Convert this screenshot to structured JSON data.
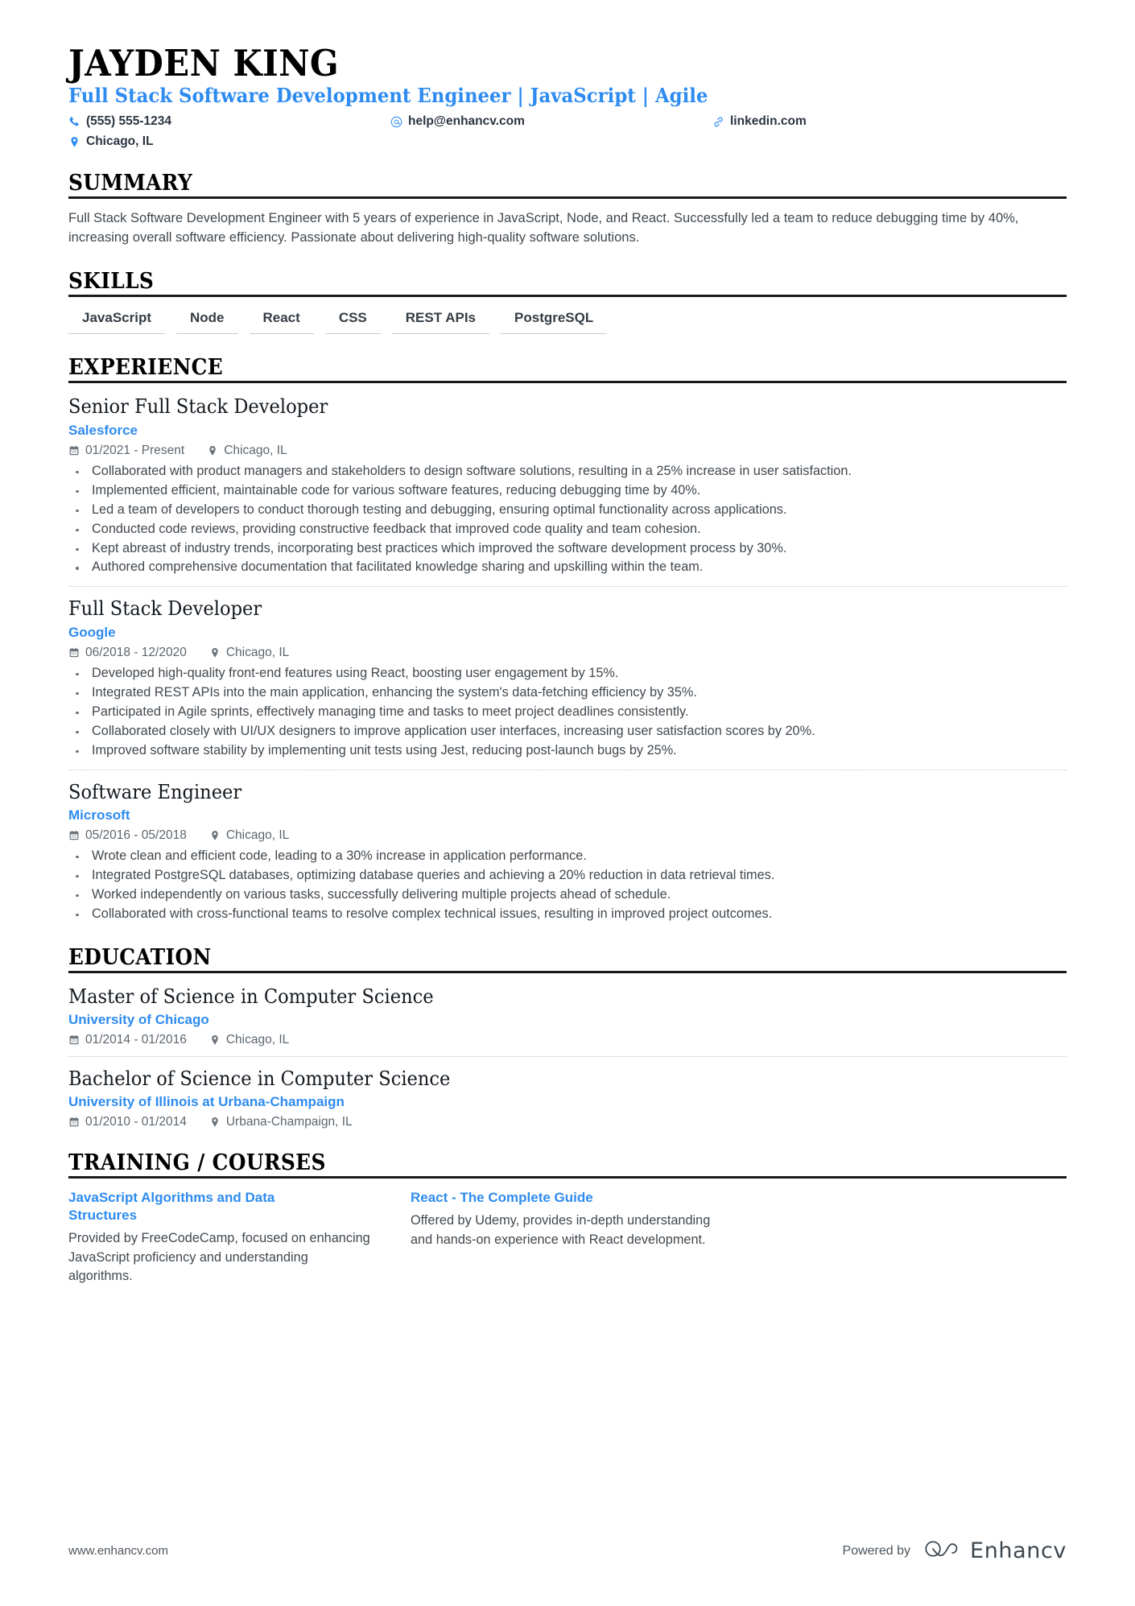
{
  "header": {
    "name": "JAYDEN KING",
    "headline": "Full Stack Software Development Engineer | JavaScript | Agile",
    "contacts": [
      {
        "icon": "phone-icon",
        "text": "(555) 555-1234"
      },
      {
        "icon": "email-icon",
        "text": "help@enhancv.com"
      },
      {
        "icon": "link-icon",
        "text": "linkedin.com"
      },
      {
        "icon": "location-icon",
        "text": "Chicago, IL"
      }
    ]
  },
  "colors": {
    "accent_blue": "#2e8bf0",
    "rule_black": "#1a1a1a",
    "body_text": "#41484f",
    "muted_text": "#5c666f"
  },
  "summary": {
    "title": "SUMMARY",
    "text": "Full Stack Software Development Engineer with 5 years of experience in JavaScript, Node, and React. Successfully led a team to reduce debugging time by 40%, increasing overall software efficiency. Passionate about delivering high-quality software solutions."
  },
  "skills": {
    "title": "SKILLS",
    "items": [
      "JavaScript",
      "Node",
      "React",
      "CSS",
      "REST APIs",
      "PostgreSQL"
    ]
  },
  "experience": {
    "title": "EXPERIENCE",
    "entries": [
      {
        "role": "Senior Full Stack Developer",
        "company": "Salesforce",
        "dates": "01/2021 - Present",
        "location": "Chicago, IL",
        "bullets": [
          "Collaborated with product managers and stakeholders to design software solutions, resulting in a 25% increase in user satisfaction.",
          "Implemented efficient, maintainable code for various software features, reducing debugging time by 40%.",
          "Led a team of developers to conduct thorough testing and debugging, ensuring optimal functionality across applications.",
          "Conducted code reviews, providing constructive feedback that improved code quality and team cohesion.",
          "Kept abreast of industry trends, incorporating best practices which improved the software development process by 30%.",
          "Authored comprehensive documentation that facilitated knowledge sharing and upskilling within the team."
        ]
      },
      {
        "role": "Full Stack Developer",
        "company": "Google",
        "dates": "06/2018 - 12/2020",
        "location": "Chicago, IL",
        "bullets": [
          "Developed high-quality front-end features using React, boosting user engagement by 15%.",
          "Integrated REST APIs into the main application, enhancing the system's data-fetching efficiency by 35%.",
          "Participated in Agile sprints, effectively managing time and tasks to meet project deadlines consistently.",
          "Collaborated closely with UI/UX designers to improve application user interfaces, increasing user satisfaction scores by 20%.",
          "Improved software stability by implementing unit tests using Jest, reducing post-launch bugs by 25%."
        ]
      },
      {
        "role": "Software Engineer",
        "company": "Microsoft",
        "dates": "05/2016 - 05/2018",
        "location": "Chicago, IL",
        "bullets": [
          "Wrote clean and efficient code, leading to a 30% increase in application performance.",
          "Integrated PostgreSQL databases, optimizing database queries and achieving a 20% reduction in data retrieval times.",
          "Worked independently on various tasks, successfully delivering multiple projects ahead of schedule.",
          "Collaborated with cross-functional teams to resolve complex technical issues, resulting in improved project outcomes."
        ]
      }
    ]
  },
  "education": {
    "title": "EDUCATION",
    "entries": [
      {
        "degree": "Master of Science in Computer Science",
        "school": "University of Chicago",
        "dates": "01/2014 - 01/2016",
        "location": "Chicago, IL"
      },
      {
        "degree": "Bachelor of Science in Computer Science",
        "school": "University of Illinois at Urbana-Champaign",
        "dates": "01/2010 - 01/2014",
        "location": "Urbana-Champaign, IL"
      }
    ]
  },
  "training": {
    "title": "TRAINING / COURSES",
    "courses": [
      {
        "name": "JavaScript Algorithms and Data Structures",
        "description": "Provided by FreeCodeCamp, focused on enhancing JavaScript proficiency and understanding algorithms."
      },
      {
        "name": "React - The Complete Guide",
        "description": "Offered by Udemy, provides in-depth understanding and hands-on experience with React development."
      }
    ]
  },
  "footer": {
    "url": "www.enhancv.com",
    "powered_by": "Powered by",
    "brand": "Enhancv",
    "brand_icon": "enhancv-logo-icon"
  }
}
